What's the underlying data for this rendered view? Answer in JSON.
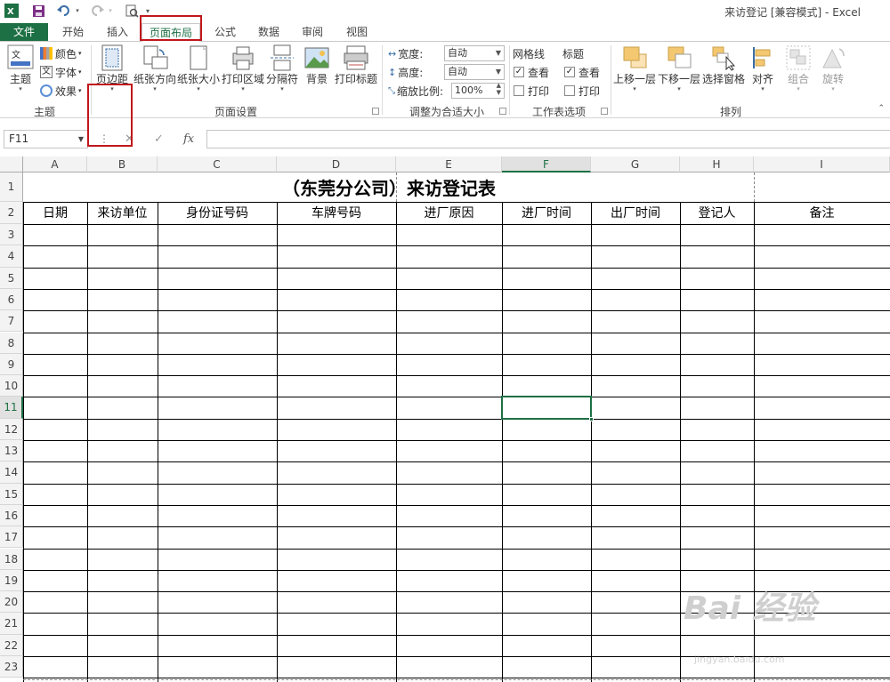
{
  "window": {
    "title": "来访登记 [兼容模式] - Excel"
  },
  "ribbon_tabs": [
    "文件",
    "开始",
    "插入",
    "页面布局",
    "公式",
    "数据",
    "审阅",
    "视图"
  ],
  "active_tab": "页面布局",
  "ribbon": {
    "theme": {
      "main": "主题",
      "colors": "颜色",
      "fonts": "字体",
      "effects": "效果",
      "group_label": "主题"
    },
    "page_setup": {
      "margins": "页边距",
      "orientation": "纸张方向",
      "size": "纸张大小",
      "print_area": "打印区域",
      "breaks": "分隔符",
      "background": "背景",
      "print_titles": "打印标题",
      "group_label": "页面设置"
    },
    "scale": {
      "width_label": "宽度:",
      "width_value": "自动",
      "height_label": "高度:",
      "height_value": "自动",
      "scale_label": "缩放比例:",
      "scale_value": "100%",
      "group_label": "调整为合适大小"
    },
    "sheet_options": {
      "gridlines": "网格线",
      "headings": "标题",
      "view": "查看",
      "print": "打印",
      "group_label": "工作表选项",
      "gridlines_view": true,
      "gridlines_print": false,
      "headings_view": true,
      "headings_print": false
    },
    "arrange": {
      "bring_forward": "上移一层",
      "send_backward": "下移一层",
      "selection_pane": "选择窗格",
      "align": "对齐",
      "group": "组合",
      "rotate": "旋转",
      "group_label": "排列"
    }
  },
  "formula_bar": {
    "name_box": "F11",
    "formula": "",
    "fx": "fx",
    "cancel": "✕",
    "enter": "✓"
  },
  "sheet": {
    "columns": [
      "A",
      "B",
      "C",
      "D",
      "E",
      "F",
      "G",
      "H",
      "I"
    ],
    "rows": [
      "1",
      "2",
      "3",
      "4",
      "5",
      "6",
      "7",
      "8",
      "9",
      "10",
      "11",
      "12",
      "13",
      "14",
      "15",
      "16",
      "17",
      "18",
      "19",
      "20",
      "21",
      "22",
      "23"
    ],
    "title": "（东莞分公司）来访登记表",
    "headers": [
      "日期",
      "来访单位",
      "身份证号码",
      "车牌号码",
      "进厂原因",
      "进厂时间",
      "出厂时间",
      "登记人",
      "备注"
    ],
    "selected_cell": "F11",
    "selected_col": "F",
    "selected_row": "11"
  },
  "watermark": {
    "text": "Bai 经验",
    "url": "jingyan.baidu.com"
  },
  "colors": {
    "excel_green": "#1d7044",
    "highlight_red": "#c0171b"
  }
}
